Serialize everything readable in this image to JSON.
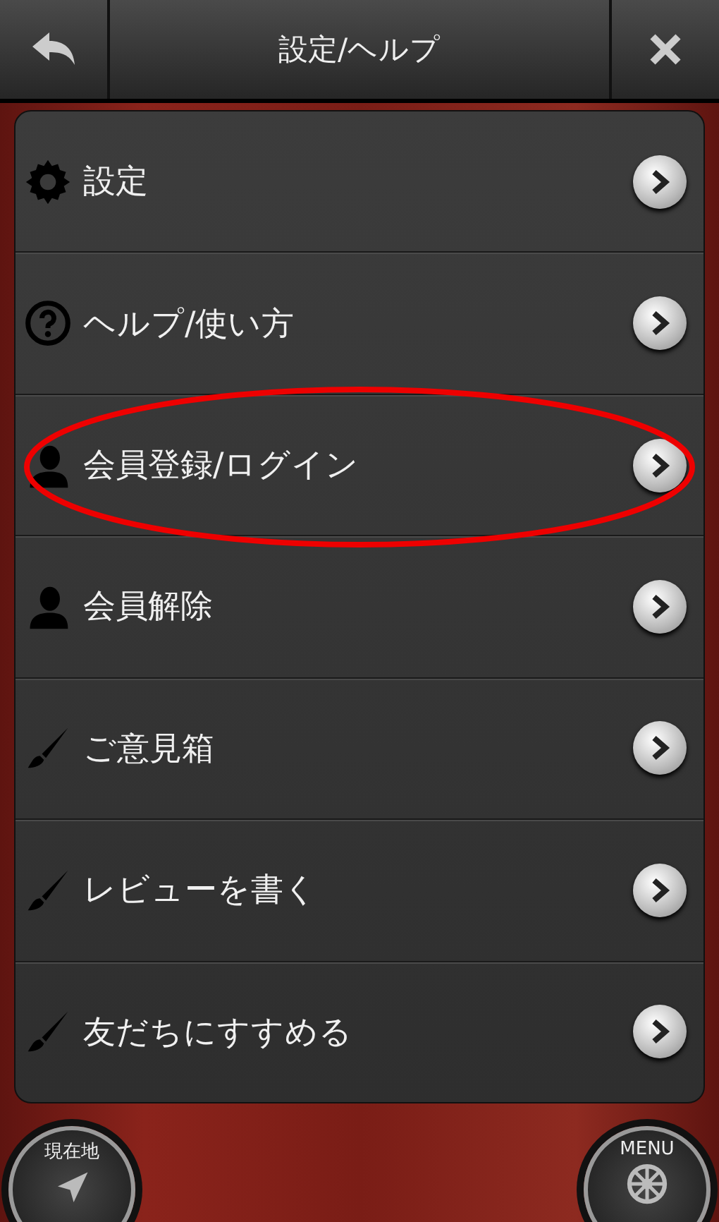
{
  "header": {
    "title": "設定/ヘルプ"
  },
  "menu_items": [
    {
      "kind": "gear",
      "label": "設定",
      "circled": false
    },
    {
      "kind": "help",
      "label": "ヘルプ/使い方",
      "circled": false
    },
    {
      "kind": "person",
      "label": "会員登録/ログイン",
      "circled": true
    },
    {
      "kind": "person",
      "label": "会員解除",
      "circled": false
    },
    {
      "kind": "brush",
      "label": "ご意見箱",
      "circled": false
    },
    {
      "kind": "brush",
      "label": "レビューを書く",
      "circled": false
    },
    {
      "kind": "brush",
      "label": "友だちにすすめる",
      "circled": false
    }
  ],
  "footer": {
    "location_button": "現在地",
    "menu_button": "MENU"
  }
}
